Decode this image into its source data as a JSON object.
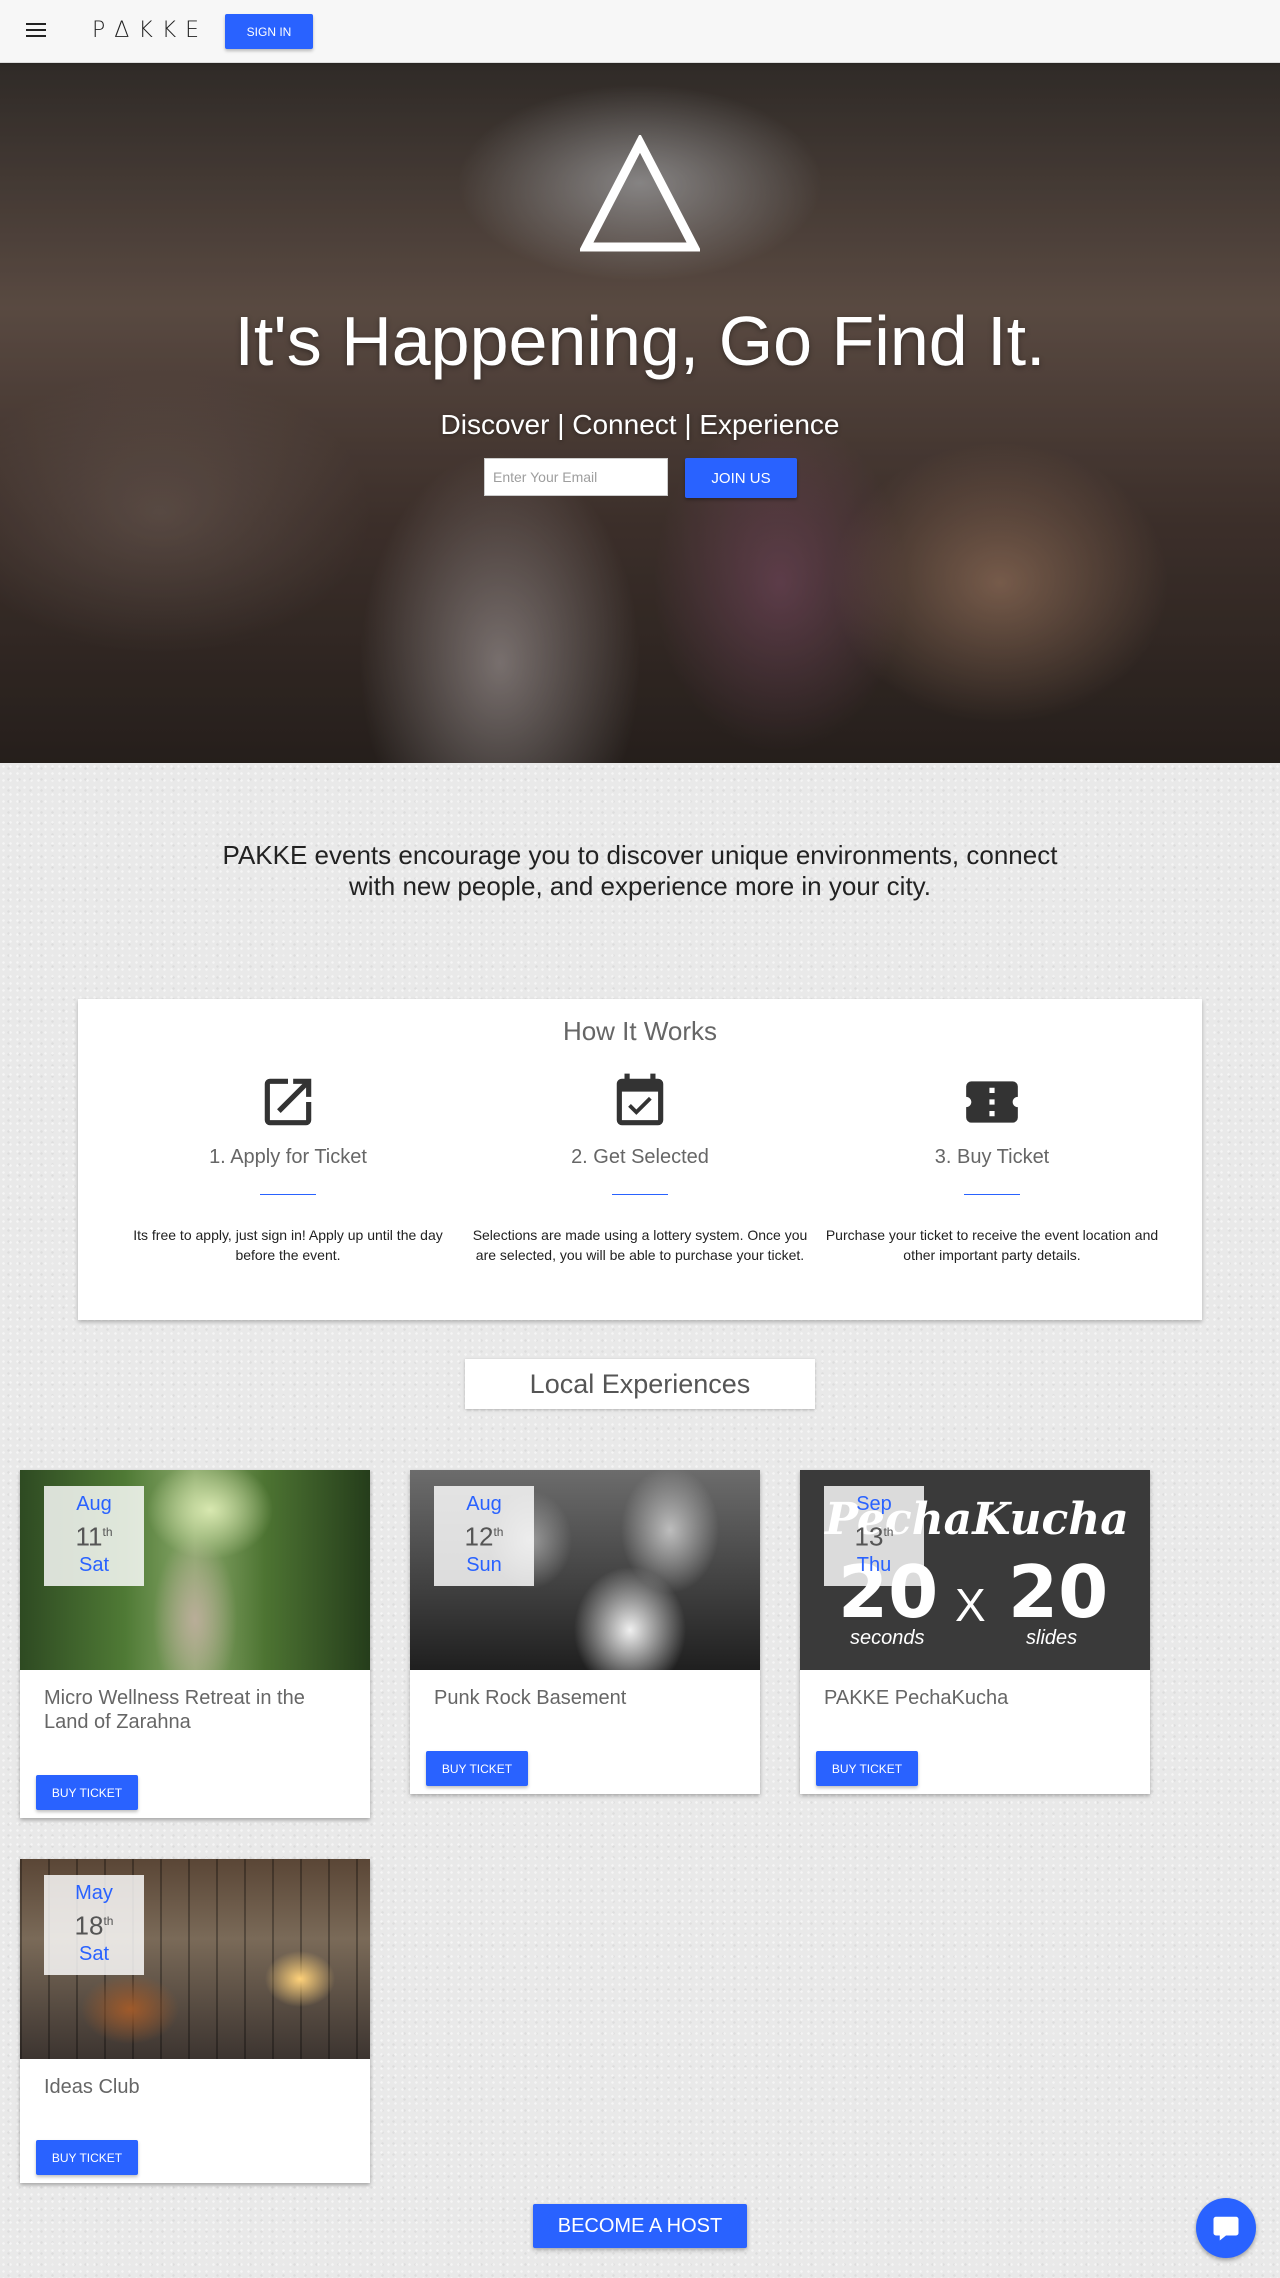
{
  "header": {
    "logo": "PΔKKE",
    "signin_label": "SIGN IN"
  },
  "hero": {
    "title": "It's Happening, Go Find It.",
    "subtitle": "Discover | Connect | Experience",
    "email_placeholder": "Enter Your Email",
    "join_label": "JOIN US"
  },
  "intro": {
    "text": "PAKKE events encourage you to discover unique environments, connect with new people, and experience more in your city."
  },
  "how_it_works": {
    "title": "How It Works",
    "steps": [
      {
        "title": "1. Apply for Ticket",
        "desc": "Its free to apply, just sign in! Apply up until the day before the event.",
        "icon": "open-in-new-icon"
      },
      {
        "title": "2. Get Selected",
        "desc": "Selections are made using a lottery system. Once you are selected, you will be able to purchase your ticket.",
        "icon": "calendar-check-icon"
      },
      {
        "title": "3. Buy Ticket",
        "desc": "Purchase your ticket to receive the event location and other important party details.",
        "icon": "ticket-icon"
      }
    ]
  },
  "local": {
    "title": "Local Experiences",
    "buy_label": "BUY TICKET",
    "events": [
      {
        "month": "Aug",
        "day": "11",
        "suffix": "th",
        "weekday": "Sat",
        "title": "Micro Wellness Retreat in the Land of Zarahna"
      },
      {
        "month": "Aug",
        "day": "12",
        "suffix": "th",
        "weekday": "Sun",
        "title": "Punk Rock Basement"
      },
      {
        "month": "Sep",
        "day": "13",
        "suffix": "th",
        "weekday": "Thu",
        "title": "PAKKE PechaKucha"
      },
      {
        "month": "May",
        "day": "18",
        "suffix": "th",
        "weekday": "Sat",
        "title": "Ideas Club"
      }
    ],
    "pecha_image": {
      "script": "PechaKucha",
      "left_number": "20",
      "x": "X",
      "right_number": "20",
      "left_caption": "seconds",
      "right_caption": "slides"
    }
  },
  "footer": {
    "host_label": "BECOME A HOST",
    "chat_icon": "chat-bubble-icon"
  },
  "colors": {
    "accent": "#2962ff",
    "card": "#ffffff",
    "text_muted": "#666666"
  }
}
